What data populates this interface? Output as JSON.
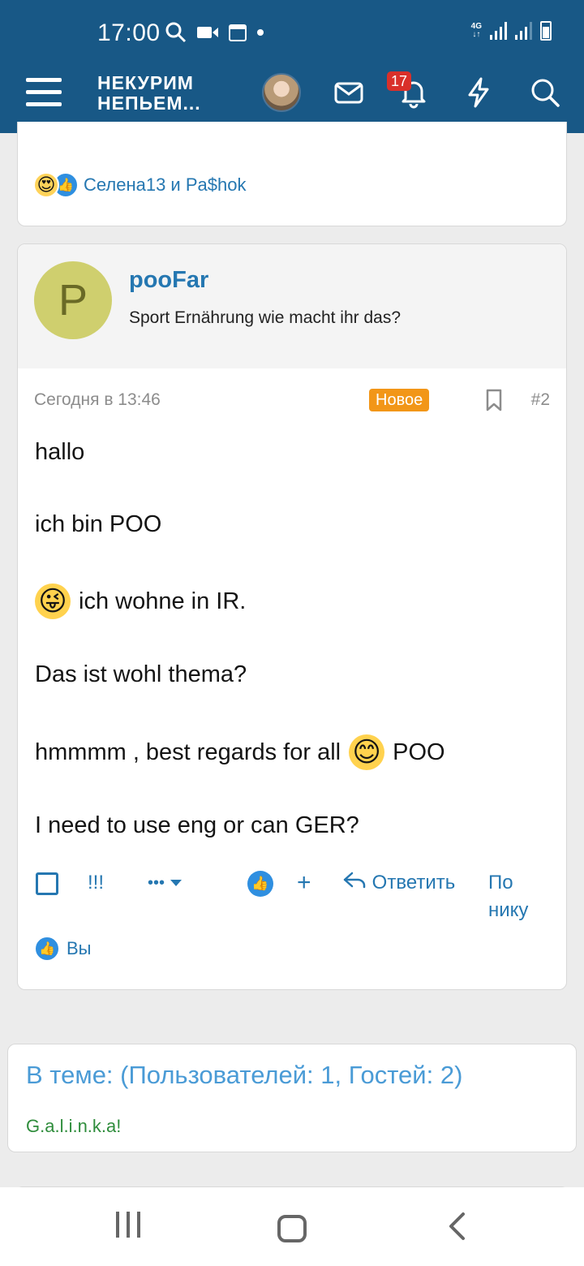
{
  "status_bar": {
    "time": "17:00",
    "network": "4G"
  },
  "header": {
    "logo_line1": "НЕКУРИМ",
    "logo_line2": "НЕПЬЕМ...",
    "notifications_count": "17",
    "icons": [
      "menu-icon",
      "avatar",
      "mail-icon",
      "bell-icon",
      "lightning-icon",
      "search-icon"
    ]
  },
  "previous_post": {
    "reactions_text": "Селена13 и Pa$hok"
  },
  "post": {
    "avatar_letter": "P",
    "username": "pooFar",
    "thread_title": "Sport Ernährung wie macht ihr das?",
    "date": "Сегодня в 13:46",
    "new_badge": "Новое",
    "number": "#2",
    "lines": [
      "hallo",
      "ich bin POO",
      "ich wohne in IR.",
      "Das ist wohl thema?",
      "hmmmm , best regards for all",
      "POO",
      "I need to use eng or can GER?"
    ],
    "actions": {
      "report": "!!!",
      "more": "•••",
      "plus": "+",
      "reply": "Ответить",
      "by_nick": "По нику"
    },
    "you_reacted": "Вы"
  },
  "online": {
    "title": "В теме: (Пользователей: 1, Гостей: 2)",
    "user": "G.a.l.i.n.k.a!"
  },
  "colors": {
    "header_bg": "#185886",
    "link": "#2577b1",
    "new_badge": "#f29618",
    "online_user": "#2f8d3c"
  }
}
